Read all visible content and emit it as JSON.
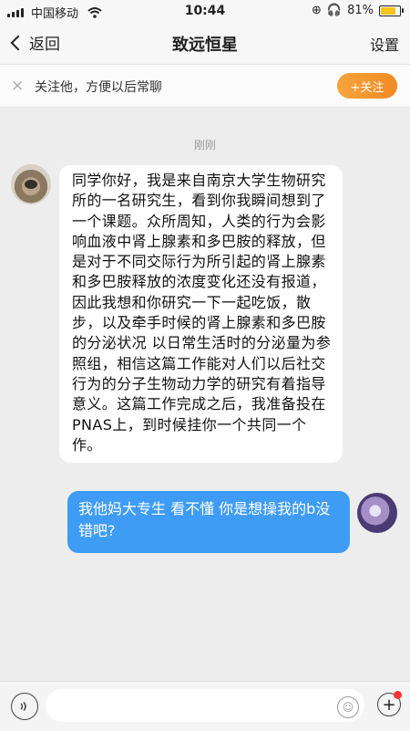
{
  "status_bar": {
    "carrier": "中国移动",
    "time": "10:44",
    "battery": "81%",
    "battery_level": 0.81
  },
  "nav": {
    "back_label": "返回",
    "title": "致远恒星",
    "settings_label": "设置"
  },
  "follow_banner": {
    "close_icon": "×",
    "text": "关注他，方便以后常聊",
    "button_label": "+关注"
  },
  "chat": {
    "timestamp": "刚刚",
    "messages": [
      {
        "side": "left",
        "text": "同学你好，我是来自南京大学生物研究所的一名研究生，看到你我瞬间想到了一个课题。众所周知，人类的行为会影响血液中肾上腺素和多巴胺的释放，但是对于不同交际行为所引起的肾上腺素和多巴胺释放的浓度变化还没有报道，因此我想和你研究一下一起吃饭，散步，以及牵手时候的肾上腺素和多巴胺的分泌状况 以日常生活时的分泌量为参照组，相信这篇工作能对人们以后社交行为的分子生物动力学的研究有着指导意义。这篇工作完成之后，我准备投在PNAS上，到时候挂你一个共同一个作。"
      },
      {
        "side": "right",
        "text": "我他妈大专生 看不懂 你是想操我的b没错吧?"
      }
    ]
  },
  "input_bar": {
    "voice_icon": "voice-icon",
    "input_value": "",
    "emoji_icon": "emoji-icon",
    "plus_icon": "plus-icon"
  },
  "colors": {
    "accent": "#f28a23",
    "sent_bubble": "#3f9cf5",
    "background": "#ededed"
  }
}
